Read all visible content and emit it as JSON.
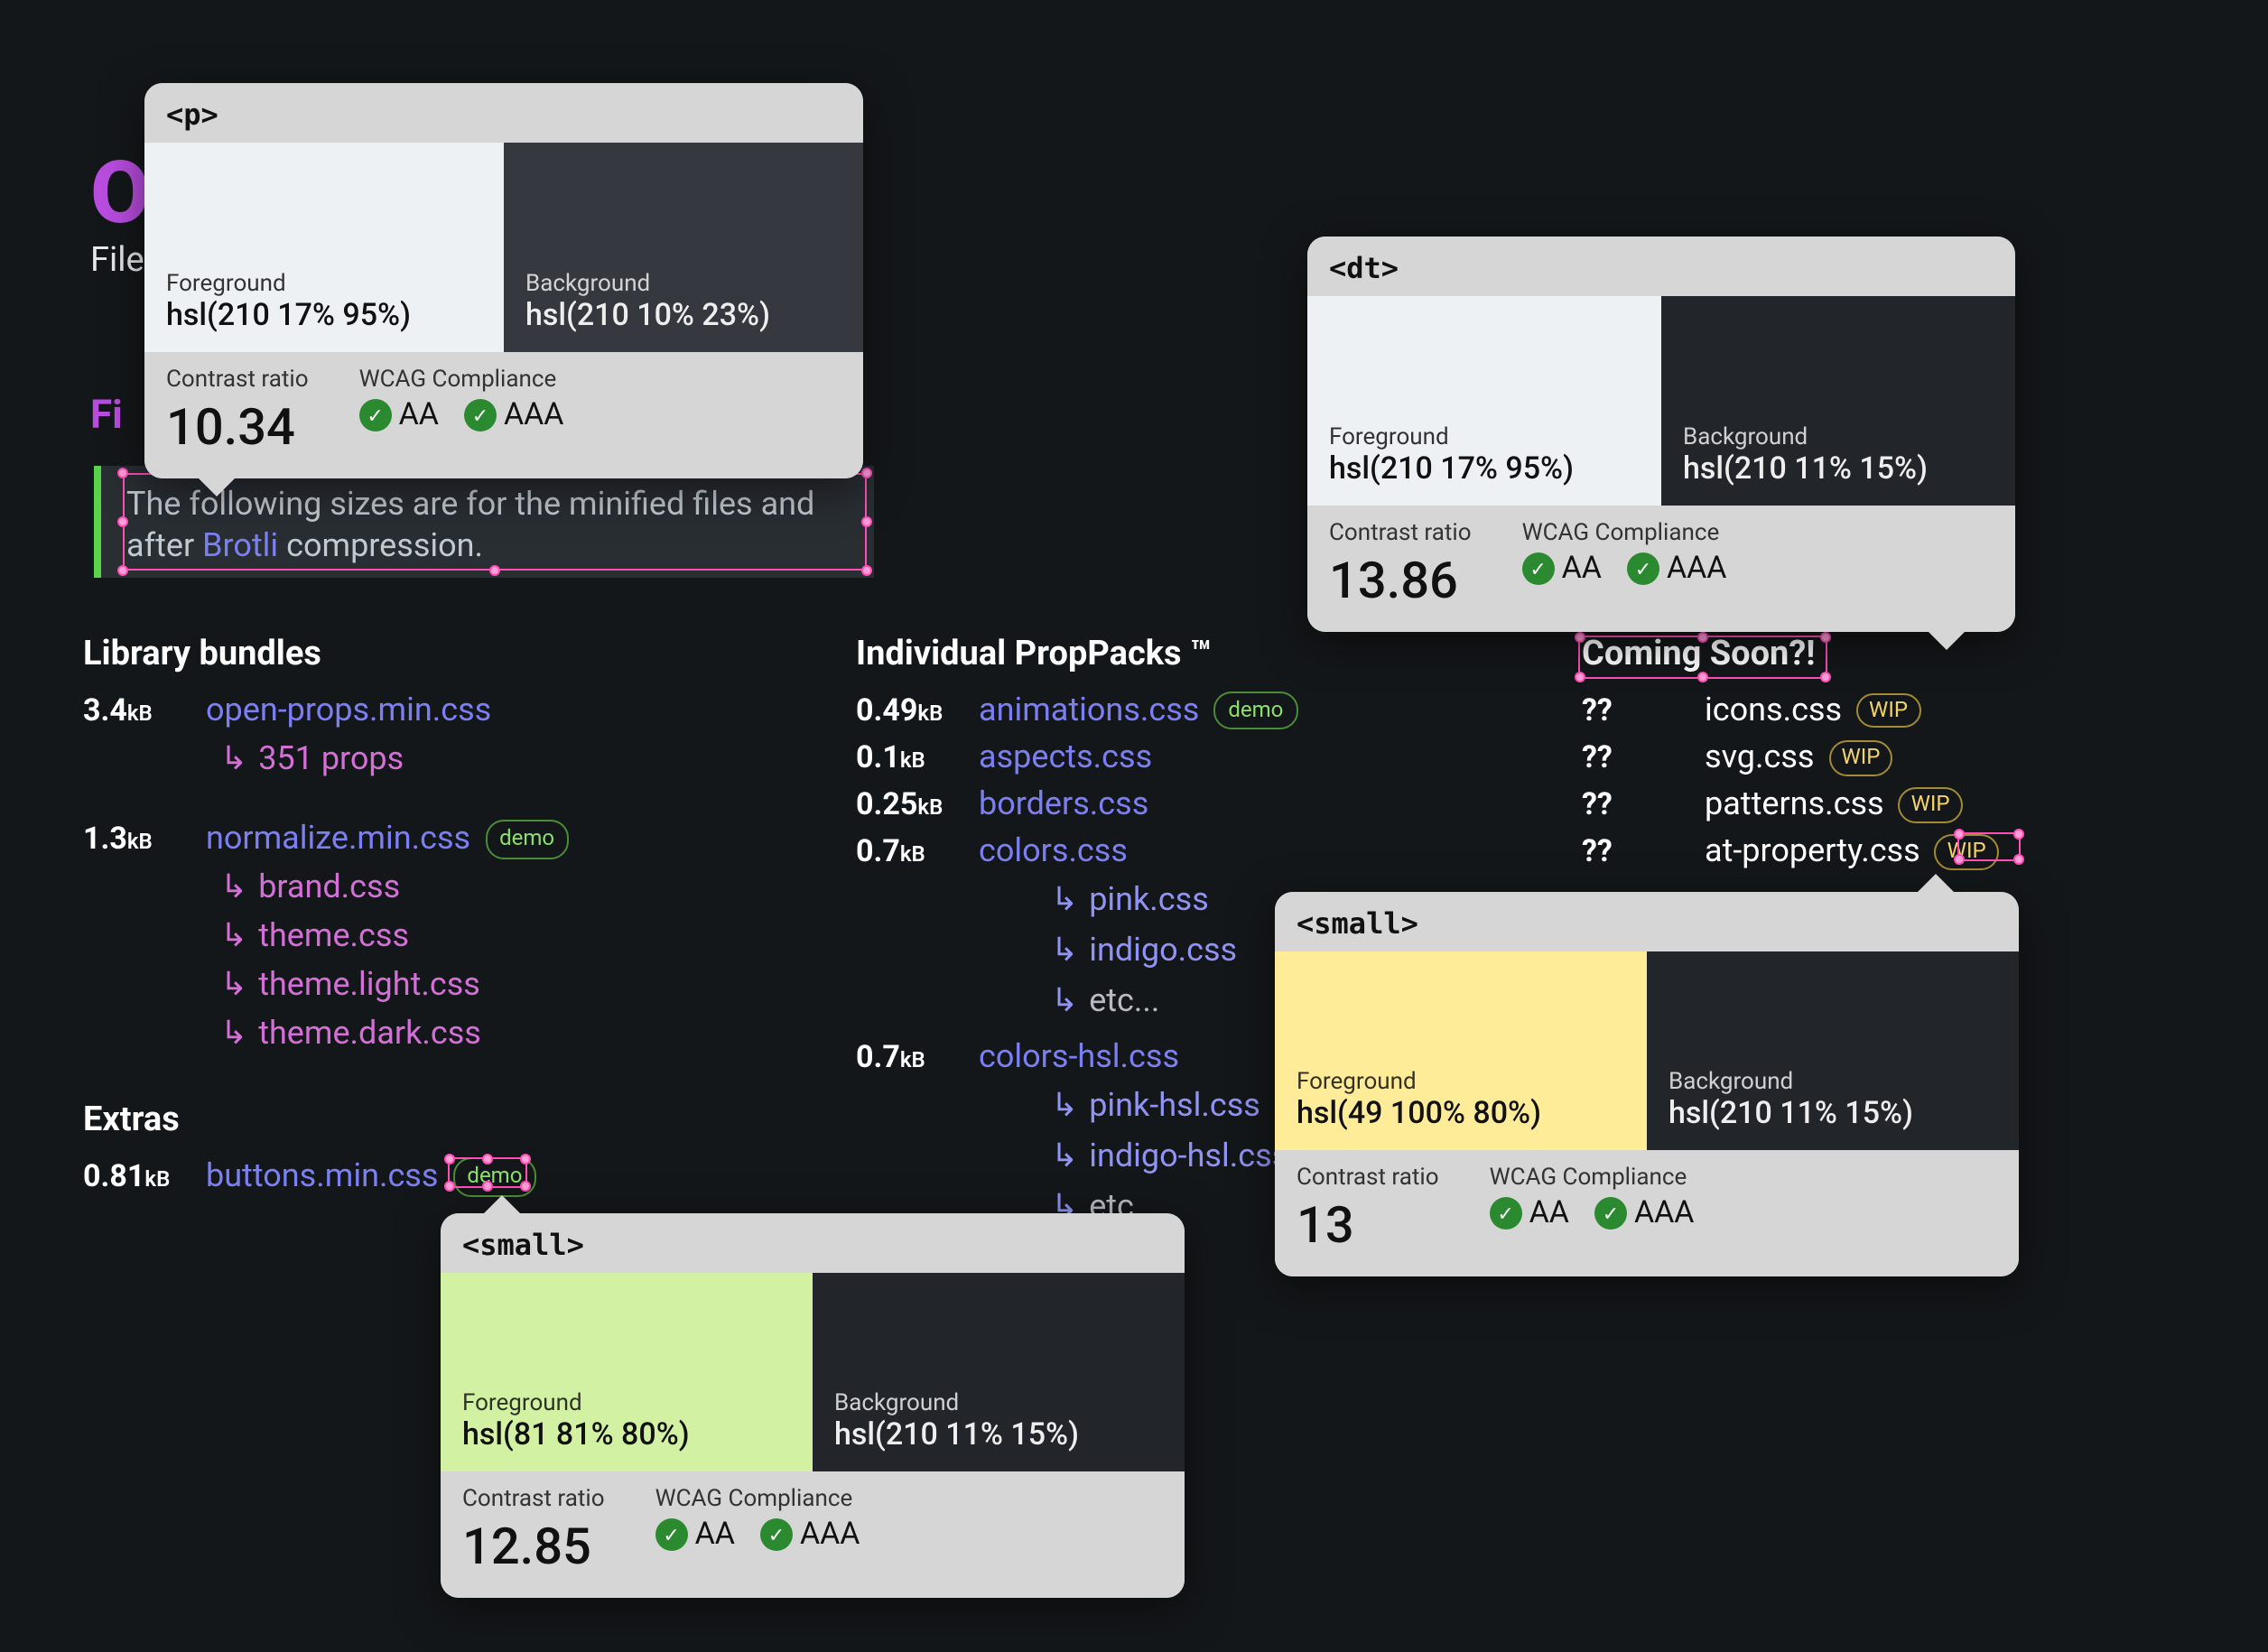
{
  "page_title_peek": "O",
  "subtitle_peek": "File",
  "section_heading_peek": "Fi",
  "callout": {
    "text_before": "The following sizes are for the minified files and after ",
    "brotli": "Brotli",
    "text_after": " compression."
  },
  "col_library": {
    "heading": "Library bundles",
    "items": [
      {
        "size": "3.4",
        "unit": "kB",
        "file": "open-props.min.css",
        "subs": [
          "351 props"
        ]
      },
      {
        "size": "1.3",
        "unit": "kB",
        "file": "normalize.min.css",
        "demo": true,
        "subs": [
          "brand.css",
          "theme.css",
          "theme.light.css",
          "theme.dark.css"
        ]
      }
    ],
    "extras_heading": "Extras",
    "extras": [
      {
        "size": "0.81",
        "unit": "kB",
        "file": "buttons.min.css",
        "demo": true
      }
    ]
  },
  "col_packs": {
    "heading": "Individual PropPacks ™",
    "items": [
      {
        "size": "0.49",
        "unit": "kB",
        "file": "animations.css",
        "demo": true
      },
      {
        "size": "0.1",
        "unit": "kB",
        "file": "aspects.css"
      },
      {
        "size": "0.25",
        "unit": "kB",
        "file": "borders.css"
      },
      {
        "size": "0.7",
        "unit": "kB",
        "file": "colors.css",
        "subs": [
          "pink.css",
          "indigo.css",
          "etc..."
        ]
      },
      {
        "size": "0.7",
        "unit": "kB",
        "file": "colors-hsl.css",
        "subs": [
          "pink-hsl.css",
          "indigo-hsl.css",
          "etc..."
        ]
      }
    ]
  },
  "col_coming": {
    "heading": "Coming Soon?!",
    "items": [
      {
        "qq": "??",
        "file": "icons.css",
        "wip": true
      },
      {
        "qq": "??",
        "file": "svg.css",
        "wip": true
      },
      {
        "qq": "??",
        "file": "patterns.css",
        "wip": true
      },
      {
        "qq": "??",
        "file": "at-property.css",
        "wip": true
      }
    ]
  },
  "labels": {
    "demo": "demo",
    "wip": "WIP",
    "foreground": "Foreground",
    "background": "Background",
    "contrast_ratio": "Contrast ratio",
    "wcag": "WCAG Compliance",
    "aa": "AA",
    "aaa": "AAA"
  },
  "tooltips": {
    "p": {
      "tag": "<p>",
      "fg_color": "hsl(210 17% 95%)",
      "bg_color": "hsl(210 10% 23%)",
      "ratio": "10.34",
      "fg_swatch": "#eef1f4",
      "bg_swatch": "#35393f"
    },
    "dt": {
      "tag": "<dt>",
      "fg_color": "hsl(210 17% 95%)",
      "bg_color": "hsl(210 11% 15%)",
      "ratio": "13.86",
      "fg_swatch": "#eef1f4",
      "bg_swatch": "#22262b"
    },
    "small_yellow": {
      "tag": "<small>",
      "fg_color": "hsl(49 100% 80%)",
      "bg_color": "hsl(210 11% 15%)",
      "ratio": "13",
      "fg_swatch": "#ffec99",
      "bg_swatch": "#22262b"
    },
    "small_green": {
      "tag": "<small>",
      "fg_color": "hsl(81 81% 80%)",
      "bg_color": "hsl(210 11% 15%)",
      "ratio": "12.85",
      "fg_swatch": "#d3f1a3",
      "bg_swatch": "#22262b"
    }
  }
}
